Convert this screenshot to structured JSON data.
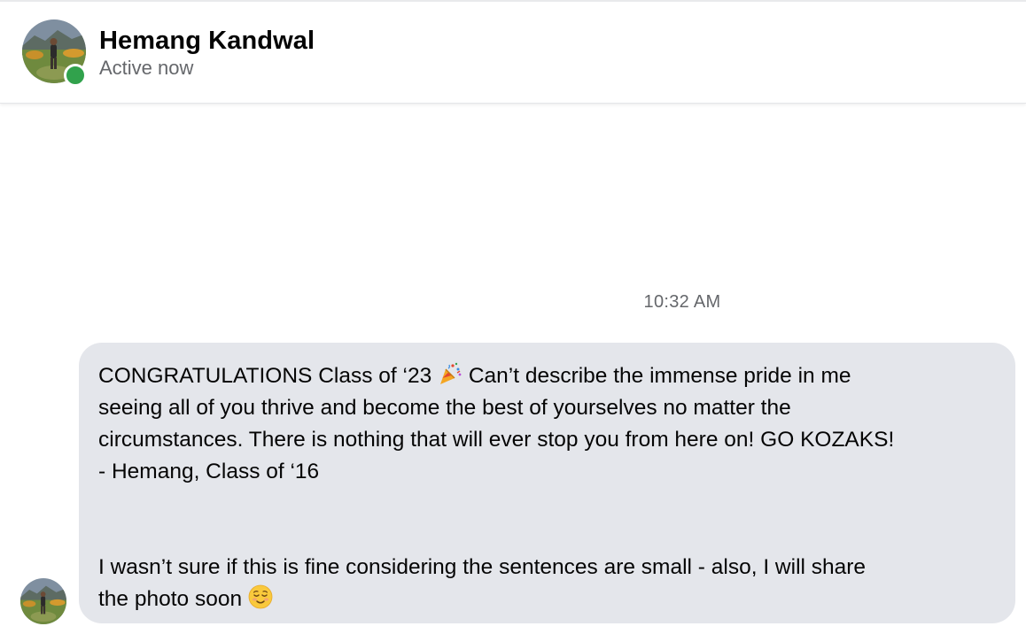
{
  "header": {
    "contact_name": "Hemang Kandwal",
    "status": "Active now",
    "presence_color": "#31a24c"
  },
  "conversation": {
    "timestamp": "10:32 AM",
    "message": {
      "bubble_color": "#e4e6eb",
      "line1_before_emoji": "CONGRATULATIONS Class of ‘23 ",
      "line1_emoji": "party-popper-emoji",
      "line1_after_emoji": " Can’t describe the immense pride in me",
      "line2": "seeing all of you thrive and become the best of yourselves no matter the",
      "line3": "circumstances. There is nothing that will ever stop you from here on! GO KOZAKS!",
      "line4": "- Hemang, Class of ‘16",
      "line5": "I wasn’t sure if this is fine considering the sentences are small - also, I will share",
      "line6_before_emoji": "the photo soon ",
      "line6_emoji": "relieved-face-emoji"
    }
  }
}
